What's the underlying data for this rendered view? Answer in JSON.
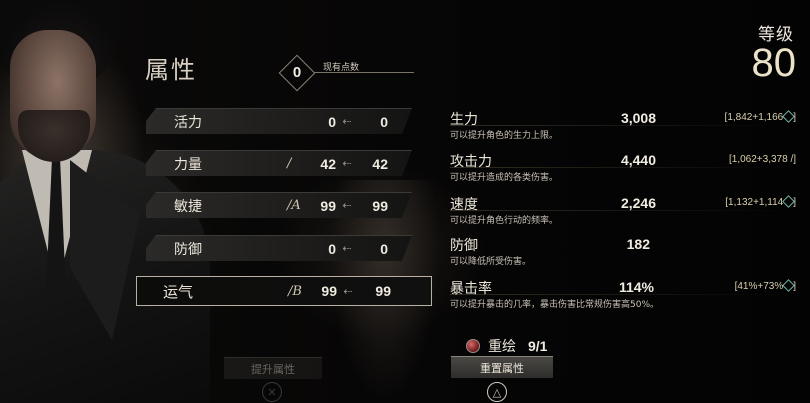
{
  "header": {
    "title": "属性",
    "points_value": "0",
    "points_label": "现有点数",
    "level_label": "等级",
    "level_value": "80"
  },
  "attributes": [
    {
      "name": "活力",
      "icon": "",
      "base": "0",
      "new": "0",
      "selected": false
    },
    {
      "name": "力量",
      "icon": "/",
      "base": "42",
      "new": "42",
      "selected": false
    },
    {
      "name": "敏捷",
      "icon": "/A",
      "base": "99",
      "new": "99",
      "selected": false
    },
    {
      "name": "防御",
      "icon": "",
      "base": "0",
      "new": "0",
      "selected": false
    },
    {
      "name": "运气",
      "icon": "/B",
      "base": "99",
      "new": "99",
      "selected": true
    }
  ],
  "arrow_glyph": "⇠",
  "stats": [
    {
      "name": "生力",
      "desc": "可以提升角色的生力上限。",
      "value": "3,008",
      "breakdown": "[1,842+1,166",
      "breakdown_icon": "diamond-icon",
      "breakdown_end": "]"
    },
    {
      "name": "攻击力",
      "desc": "可以提升造成的各类伤害。",
      "value": "4,440",
      "breakdown": "[1,062+3,378",
      "breakdown_icon": "slash-icon",
      "breakdown_end": "/]"
    },
    {
      "name": "速度",
      "desc": "可以提升角色行动的频率。",
      "value": "2,246",
      "breakdown": "[1,132+1,114",
      "breakdown_icon": "diamond-icon",
      "breakdown_end": "]"
    },
    {
      "name": "防御",
      "desc": "可以降低所受伤害。",
      "value": "182",
      "breakdown": "",
      "breakdown_icon": "",
      "breakdown_end": ""
    },
    {
      "name": "暴击率",
      "desc": "可以提升暴击的几率，暴击伤害比常规伤害高50%。",
      "value": "114%",
      "breakdown": "[41%+73%",
      "breakdown_icon": "diamond-icon",
      "breakdown_end": "]"
    }
  ],
  "footer": {
    "heavy_label": "重绘",
    "heavy_count": "9/1",
    "upgrade_button": "提升属性",
    "reset_button": "重置属性",
    "cancel_glyph": "✕",
    "confirm_glyph": "△"
  },
  "colors": {
    "accent_gold": "#ece2c8",
    "breakdown_text": "#d9cfae",
    "breakdown_icon": "#6fb7a7"
  }
}
